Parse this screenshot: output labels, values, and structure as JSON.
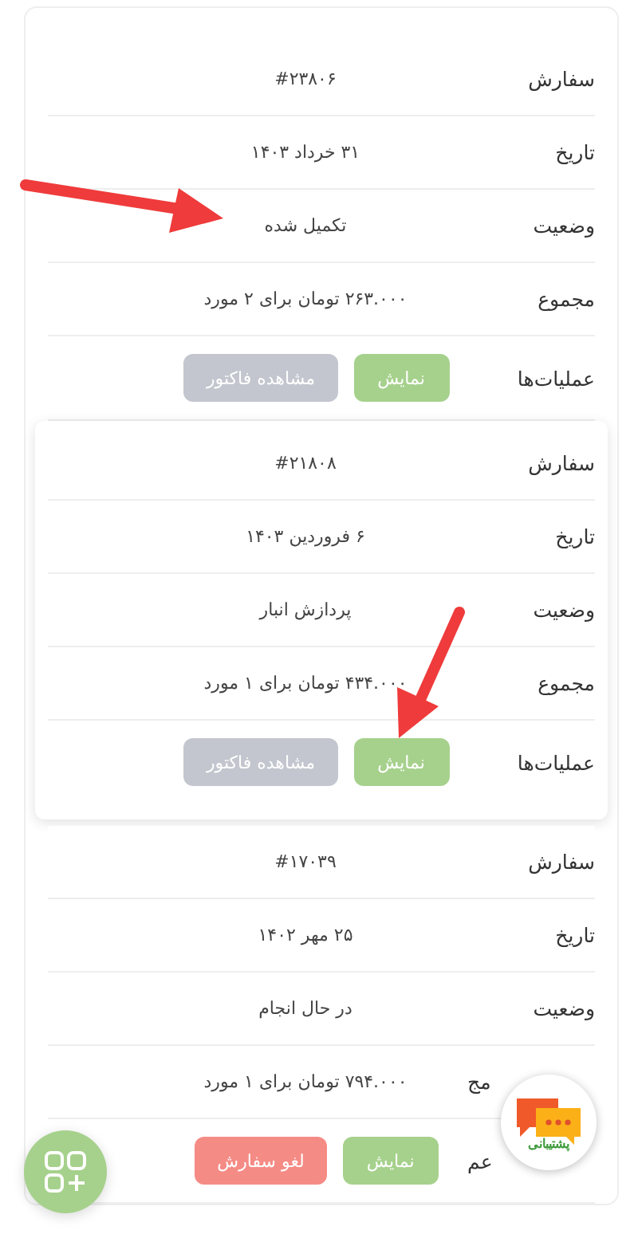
{
  "orders": [
    {
      "highlighted": false,
      "rows": [
        {
          "kind": "text",
          "label": "سفارش",
          "value": "#۲۳۸۰۶"
        },
        {
          "kind": "text",
          "label": "تاریخ",
          "value": "۳۱ خرداد ۱۴۰۳"
        },
        {
          "kind": "text",
          "label": "وضعیت",
          "value": "تکمیل شده"
        },
        {
          "kind": "text",
          "label": "مجموع",
          "value": "۲۶۳.۰۰۰ تومان برای ۲ مورد"
        },
        {
          "kind": "actions",
          "label": "عملیات‌ها",
          "buttons": [
            {
              "kind": "show",
              "label": "نمایش"
            },
            {
              "kind": "invoice",
              "label": "مشاهده فاکتور"
            }
          ]
        }
      ]
    },
    {
      "highlighted": true,
      "rows": [
        {
          "kind": "text",
          "label": "سفارش",
          "value": "#۲۱۸۰۸"
        },
        {
          "kind": "text",
          "label": "تاریخ",
          "value": "۶ فروردین ۱۴۰۳"
        },
        {
          "kind": "text",
          "label": "وضعیت",
          "value": "پردازش انبار"
        },
        {
          "kind": "text",
          "label": "مجموع",
          "value": "۴۳۴.۰۰۰ تومان برای ۱ مورد"
        },
        {
          "kind": "actions",
          "label": "عملیات‌ها",
          "buttons": [
            {
              "kind": "show",
              "label": "نمایش"
            },
            {
              "kind": "invoice",
              "label": "مشاهده فاکتور"
            }
          ]
        }
      ]
    },
    {
      "highlighted": false,
      "rows": [
        {
          "kind": "text",
          "label": "سفارش",
          "value": "#۱۷۰۳۹"
        },
        {
          "kind": "text",
          "label": "تاریخ",
          "value": "۲۵ مهر ۱۴۰۲"
        },
        {
          "kind": "text",
          "label": "وضعیت",
          "value": "در حال انجام"
        },
        {
          "kind": "text",
          "label": "مج",
          "covered": true,
          "value": "۷۹۴.۰۰۰ تومان برای ۱ مورد"
        },
        {
          "kind": "actions",
          "label": "عم",
          "covered": true,
          "buttons": [
            {
              "kind": "show",
              "label": "نمایش"
            },
            {
              "kind": "cancel",
              "label": "لغو سفارش"
            }
          ]
        }
      ]
    }
  ],
  "support": {
    "label": "پشتیبانی"
  }
}
